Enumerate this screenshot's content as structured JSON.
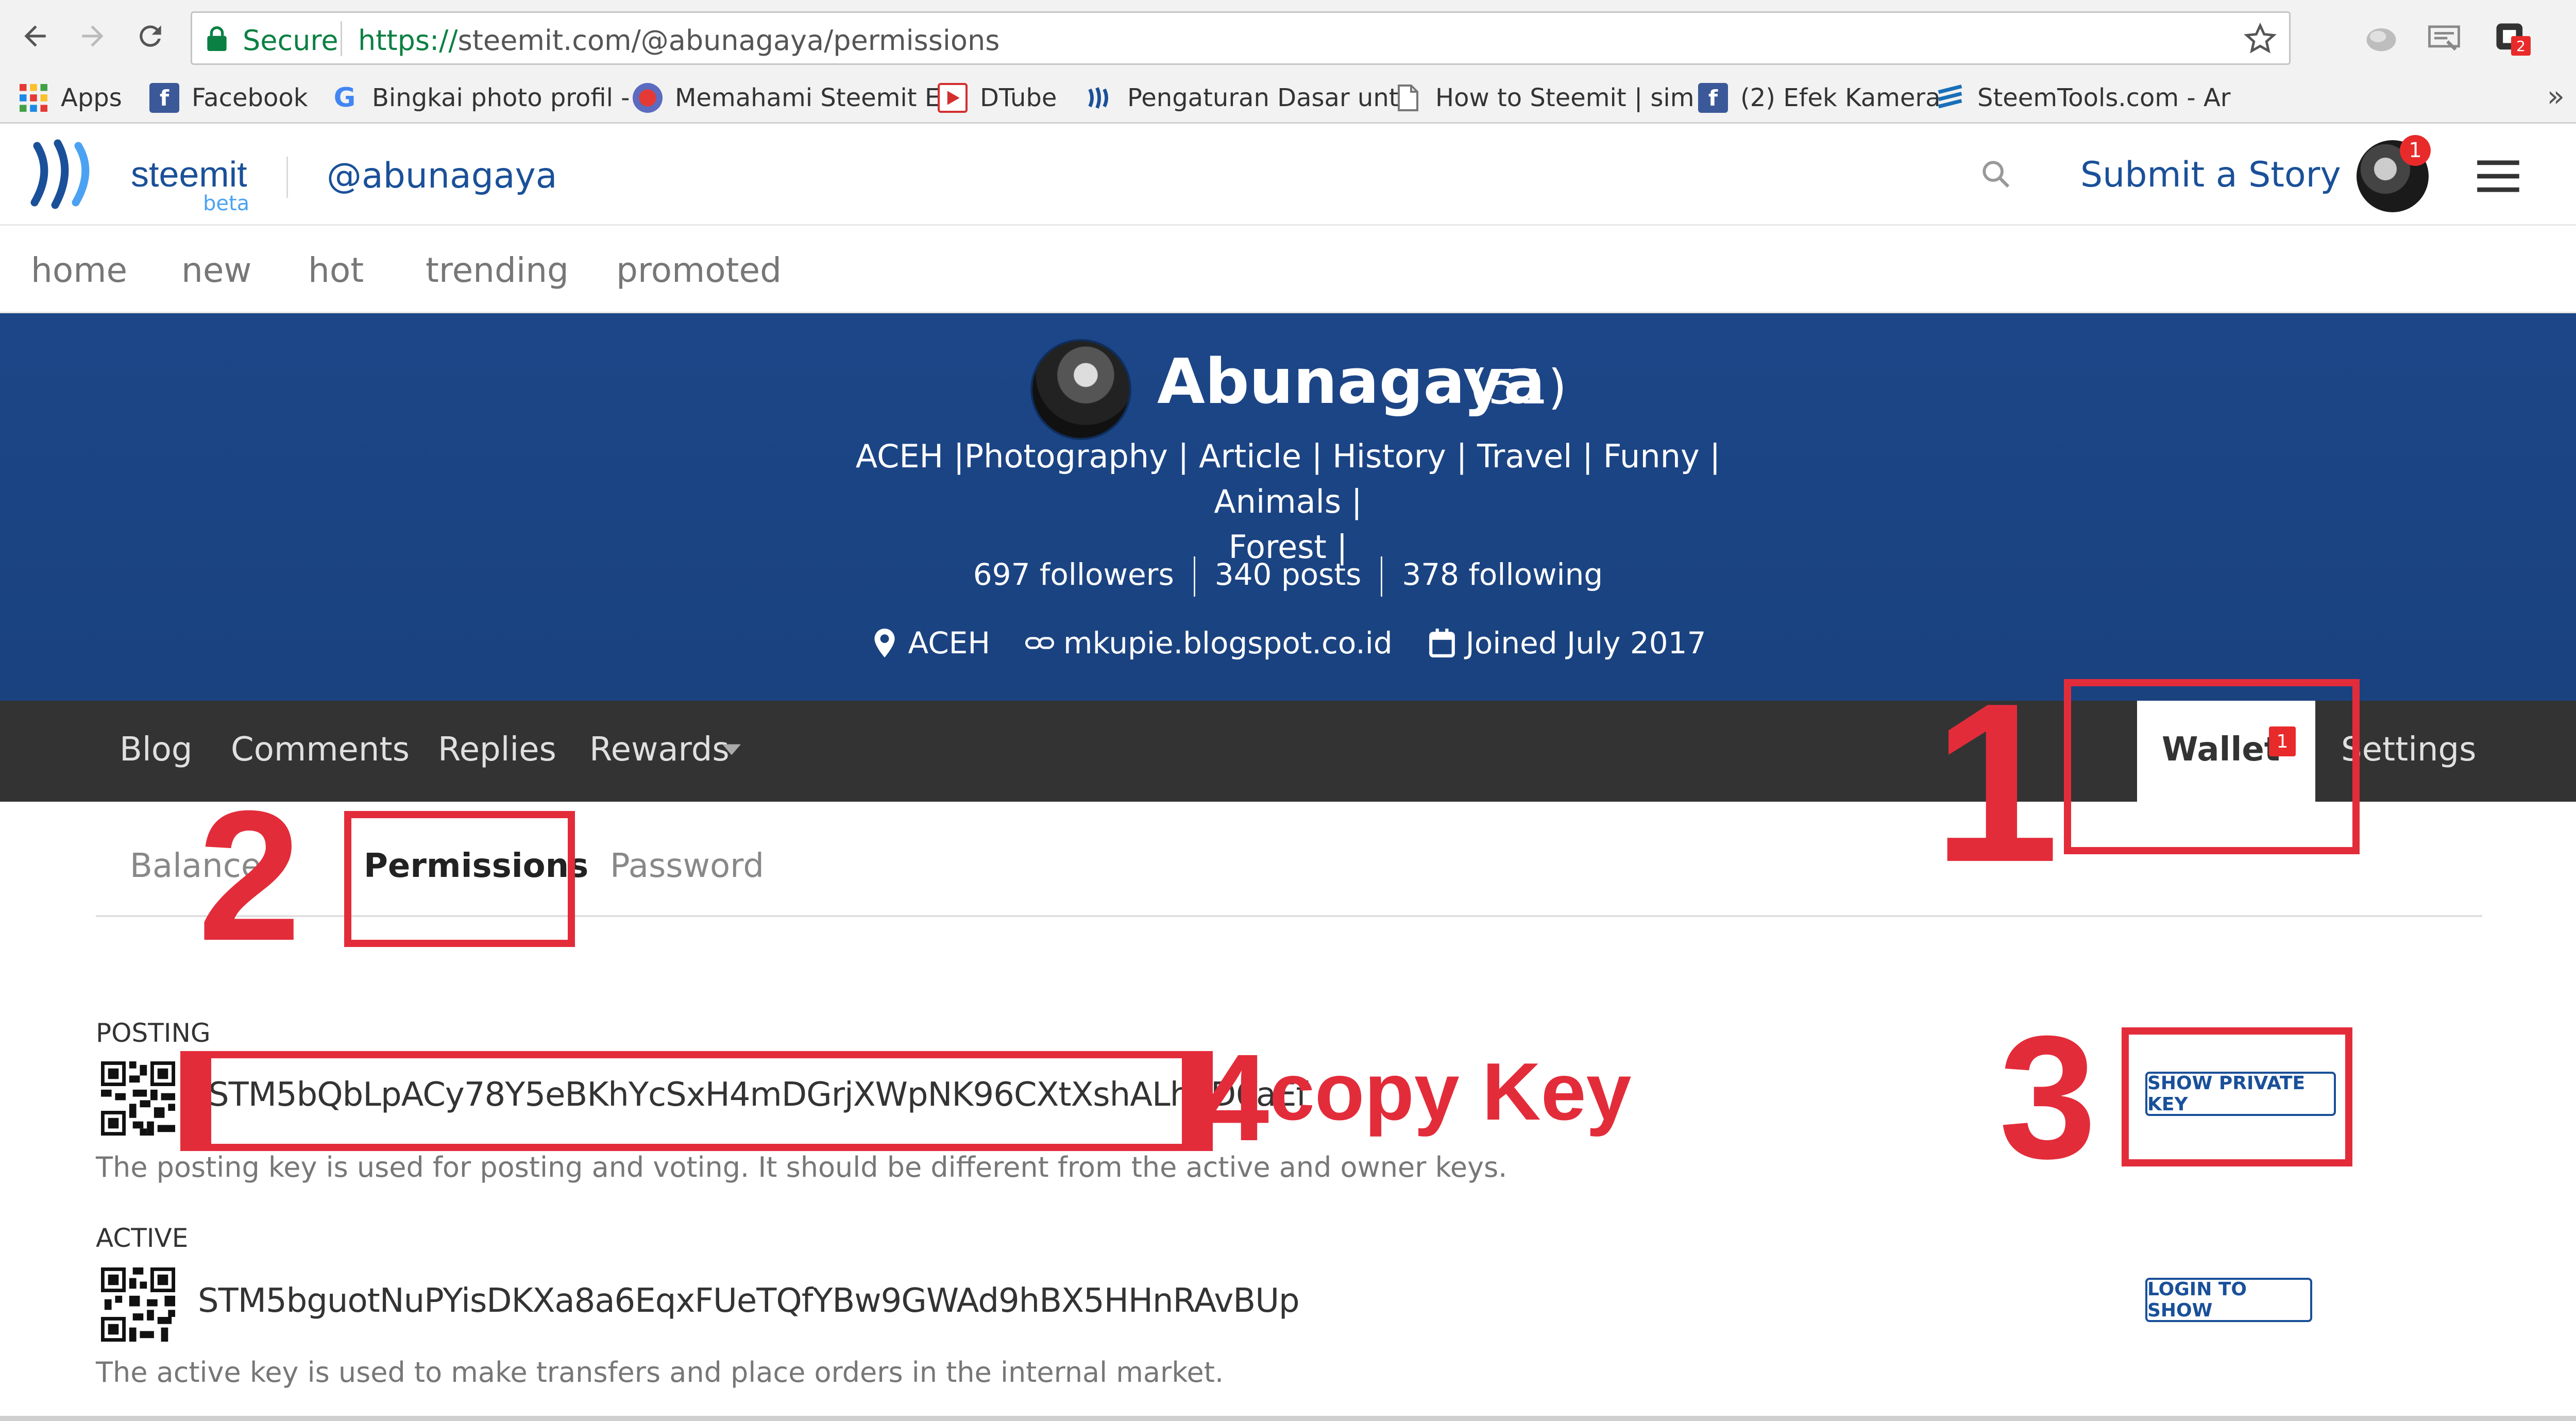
{
  "browser": {
    "secure_label": "Secure",
    "url_protocol": "https://",
    "url_rest": "steemit.com/@abunagaya/permissions",
    "extension_badge": "2",
    "bookmarks": [
      {
        "label": "Apps",
        "icon": "apps-grid-icon"
      },
      {
        "label": "Facebook",
        "icon": "facebook-icon"
      },
      {
        "label": "Bingkai photo profil -",
        "icon": "google-icon"
      },
      {
        "label": "Memahami Steemit E",
        "icon": "avatar-icon"
      },
      {
        "label": "DTube",
        "icon": "dtube-icon"
      },
      {
        "label": "Pengaturan Dasar unt",
        "icon": "steemit-icon"
      },
      {
        "label": "How to Steemit | sim",
        "icon": "page-icon"
      },
      {
        "label": "(2) Efek Kamera",
        "icon": "facebook-icon"
      },
      {
        "label": "SteemTools.com - Ar",
        "icon": "steemtools-icon"
      }
    ],
    "more_bookmarks": "»"
  },
  "header": {
    "brand": "steemit",
    "beta": "beta",
    "username": "@abunagaya",
    "submit_label": "Submit a Story",
    "avatar_badge": "1"
  },
  "subnav": [
    "home",
    "new",
    "hot",
    "trending",
    "promoted"
  ],
  "profile": {
    "name": "Abunagaya",
    "reputation": "(51)",
    "about_line1": "ACEH |Photography | Article | History | Travel | Funny | Animals |",
    "about_line2": "Forest |",
    "followers": "697 followers",
    "posts": "340 posts",
    "following": "378 following",
    "location": "ACEH",
    "website": "mkupie.blogspot.co.id",
    "joined": "Joined July 2017"
  },
  "profile_tabs": {
    "blog": "Blog",
    "comments": "Comments",
    "replies": "Replies",
    "rewards": "Rewards",
    "wallet": "Wallet",
    "wallet_badge": "1",
    "settings": "Settings"
  },
  "wallet_tabs": {
    "balances": "Balances",
    "permissions": "Permissions",
    "password": "Password"
  },
  "permissions": {
    "posting": {
      "label": "POSTING",
      "key": "STM5bQbLpACy78Y5eBKhYcSxH4mDGrjXWpNK96CXtXshALh7D6aEf",
      "desc": "The posting key is used for posting and voting. It should be different from the active and owner keys.",
      "button": "SHOW PRIVATE KEY"
    },
    "active": {
      "label": "ACTIVE",
      "key": "STM5bguotNuPYisDKXa8a6EqxFUeTQfYBw9GWAd9hBX5HHnRAvBUp",
      "desc": "The active key is used to make transfers and place orders in the internal market.",
      "button": "LOGIN TO SHOW"
    }
  },
  "annotations": {
    "step1": "1",
    "step2": "2",
    "step3": "3",
    "step4": "4",
    "step4_text": "copy Key",
    "color": "#e32c3a"
  }
}
